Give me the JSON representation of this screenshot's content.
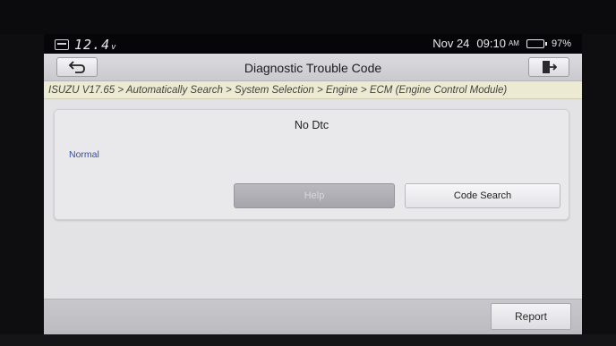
{
  "status_bar": {
    "voltage": "12.4",
    "voltage_unit": "v",
    "date": "Nov 24",
    "time": "09:10",
    "ampm": "AM",
    "battery_percent": "97%",
    "battery_level": 0.97,
    "icons": {
      "car": "vehicle-connection-icon",
      "battery": "battery-icon"
    }
  },
  "header": {
    "title": "Diagnostic Trouble Code",
    "back_icon": "back-arrow-icon",
    "exit_icon": "exit-door-icon"
  },
  "breadcrumb": "ISUZU V17.65 > Automatically Search > System Selection > Engine > ECM (Engine Control Module)",
  "card": {
    "title": "No Dtc",
    "status": "Normal",
    "help_label": "Help",
    "code_search_label": "Code Search"
  },
  "footer": {
    "report_label": "Report"
  },
  "colors": {
    "status_text": "#2c4fb8",
    "battery_fill": "#2fd03a",
    "breadcrumb_bg": "#ecead2"
  }
}
